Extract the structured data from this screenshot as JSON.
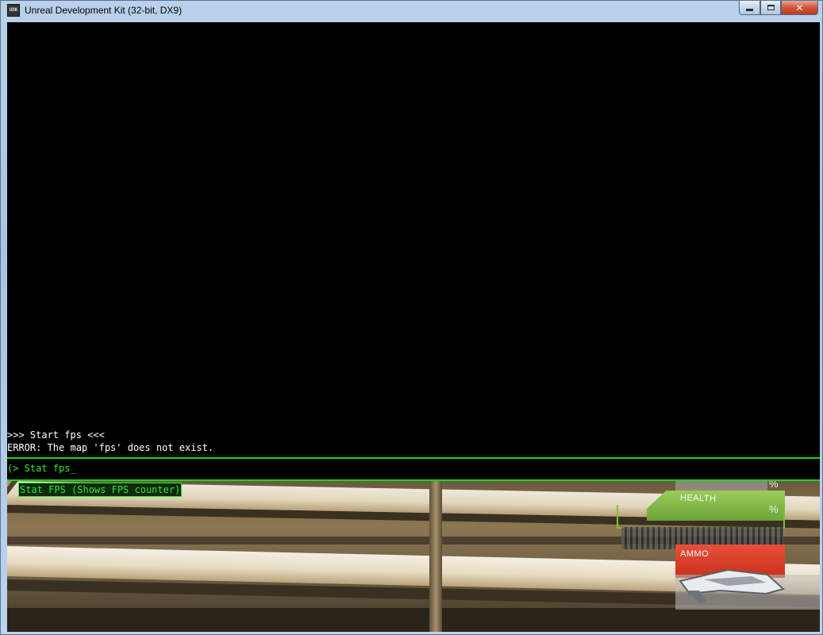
{
  "window": {
    "title": "Unreal Development Kit (32-bit, DX9)",
    "icon_text": "UDK",
    "close_glyph": "✕"
  },
  "console": {
    "log": [
      ">>> Start fps <<<",
      "ERROR: The map 'fps' does not exist."
    ],
    "input": "(> Stat fps_",
    "autocomplete": "Stat FPS (Shows FPS counter)",
    "colors": {
      "text": "#ffffff",
      "accent": "#2ee62e"
    }
  },
  "hud": {
    "top_percent": "%",
    "health_label": "HEALTH",
    "health_percent": "%",
    "ammo_label": "AMMO",
    "colors": {
      "health": "#7fbe3c",
      "ammo": "#d83a22"
    }
  }
}
